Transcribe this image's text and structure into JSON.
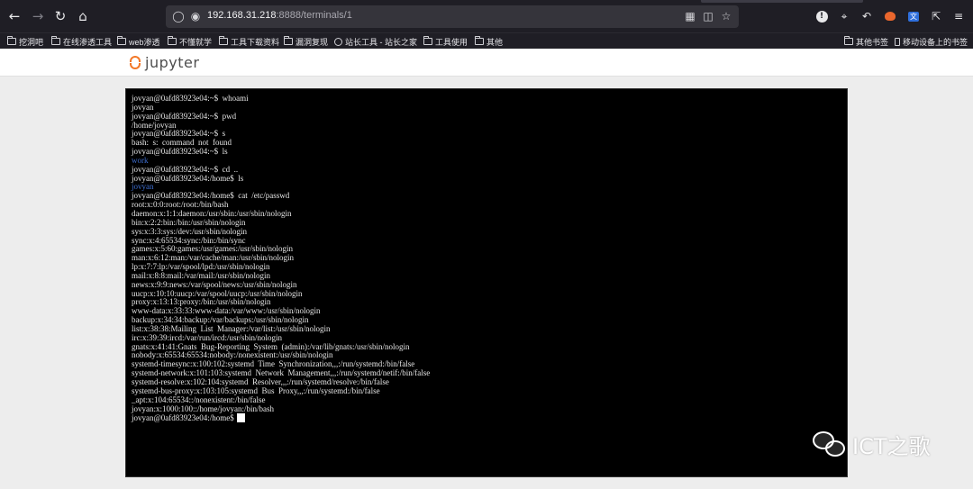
{
  "browser": {
    "url_host": "192.168.31.218",
    "url_rest": ":8888/terminals/1",
    "nav_icons": [
      "back-icon",
      "forward-icon",
      "reload-icon",
      "home-icon"
    ],
    "urlbar_icons": [
      "tracking-shield-icon",
      "lock-icon",
      "qr-code-icon",
      "translate-icon",
      "bookmark-star-icon"
    ],
    "extensions": [
      "info-icon",
      "crop-icon",
      "undo-icon",
      "fox-icon",
      "translate-ext-icon",
      "share-icon",
      "menu-icon"
    ]
  },
  "bookmarks": {
    "left": [
      {
        "label": "挖洞吧"
      },
      {
        "label": "在线渗透工具"
      },
      {
        "label": "web渗透"
      },
      {
        "label": "不懂就学"
      },
      {
        "label": "工具下载资料"
      },
      {
        "label": "漏洞复现"
      },
      {
        "label": "站长工具 - 站长之家"
      },
      {
        "label": "工具使用"
      },
      {
        "label": "其他"
      }
    ],
    "right": [
      {
        "label": "其他书签"
      },
      {
        "label": "移动设备上的书签"
      }
    ]
  },
  "jupyter": {
    "logo_text": "jupyter",
    "accent": "#f37726"
  },
  "terminal": {
    "lines": [
      {
        "text": "jovyan@0afd83923e04:~$  whoami",
        "kind": "normal"
      },
      {
        "text": "jovyan",
        "kind": "normal"
      },
      {
        "text": "jovyan@0afd83923e04:~$  pwd",
        "kind": "normal"
      },
      {
        "text": "/home/jovyan",
        "kind": "normal"
      },
      {
        "text": "jovyan@0afd83923e04:~$  s",
        "kind": "normal"
      },
      {
        "text": "bash:  s:  command  not  found",
        "kind": "normal"
      },
      {
        "text": "jovyan@0afd83923e04:~$  ls",
        "kind": "normal"
      },
      {
        "text": "work",
        "kind": "dir"
      },
      {
        "text": "jovyan@0afd83923e04:~$  cd  ..",
        "kind": "normal"
      },
      {
        "text": "jovyan@0afd83923e04:/home$  ls",
        "kind": "normal"
      },
      {
        "text": "jovyan",
        "kind": "dir"
      },
      {
        "text": "jovyan@0afd83923e04:/home$  cat  /etc/passwd",
        "kind": "normal"
      },
      {
        "text": "root:x:0:0:root:/root:/bin/bash",
        "kind": "normal"
      },
      {
        "text": "daemon:x:1:1:daemon:/usr/sbin:/usr/sbin/nologin",
        "kind": "normal"
      },
      {
        "text": "bin:x:2:2:bin:/bin:/usr/sbin/nologin",
        "kind": "normal"
      },
      {
        "text": "sys:x:3:3:sys:/dev:/usr/sbin/nologin",
        "kind": "normal"
      },
      {
        "text": "sync:x:4:65534:sync:/bin:/bin/sync",
        "kind": "normal"
      },
      {
        "text": "games:x:5:60:games:/usr/games:/usr/sbin/nologin",
        "kind": "normal"
      },
      {
        "text": "man:x:6:12:man:/var/cache/man:/usr/sbin/nologin",
        "kind": "normal"
      },
      {
        "text": "lp:x:7:7:lp:/var/spool/lpd:/usr/sbin/nologin",
        "kind": "normal"
      },
      {
        "text": "mail:x:8:8:mail:/var/mail:/usr/sbin/nologin",
        "kind": "normal"
      },
      {
        "text": "news:x:9:9:news:/var/spool/news:/usr/sbin/nologin",
        "kind": "normal"
      },
      {
        "text": "uucp:x:10:10:uucp:/var/spool/uucp:/usr/sbin/nologin",
        "kind": "normal"
      },
      {
        "text": "proxy:x:13:13:proxy:/bin:/usr/sbin/nologin",
        "kind": "normal"
      },
      {
        "text": "www-data:x:33:33:www-data:/var/www:/usr/sbin/nologin",
        "kind": "normal"
      },
      {
        "text": "backup:x:34:34:backup:/var/backups:/usr/sbin/nologin",
        "kind": "normal"
      },
      {
        "text": "list:x:38:38:Mailing  List  Manager:/var/list:/usr/sbin/nologin",
        "kind": "normal"
      },
      {
        "text": "irc:x:39:39:ircd:/var/run/ircd:/usr/sbin/nologin",
        "kind": "normal"
      },
      {
        "text": "gnats:x:41:41:Gnats  Bug-Reporting  System  (admin):/var/lib/gnats:/usr/sbin/nologin",
        "kind": "normal"
      },
      {
        "text": "nobody:x:65534:65534:nobody:/nonexistent:/usr/sbin/nologin",
        "kind": "normal"
      },
      {
        "text": "systemd-timesync:x:100:102:systemd  Time  Synchronization,,,:/run/systemd:/bin/false",
        "kind": "normal"
      },
      {
        "text": "systemd-network:x:101:103:systemd  Network  Management,,,:/run/systemd/netif:/bin/false",
        "kind": "normal"
      },
      {
        "text": "systemd-resolve:x:102:104:systemd  Resolver,,,:/run/systemd/resolve:/bin/false",
        "kind": "normal"
      },
      {
        "text": "systemd-bus-proxy:x:103:105:systemd  Bus  Proxy,,,:/run/systemd:/bin/false",
        "kind": "normal"
      },
      {
        "text": "_apt:x:104:65534::/nonexistent:/bin/false",
        "kind": "normal"
      },
      {
        "text": "jovyan:x:1000:100::/home/jovyan:/bin/bash",
        "kind": "normal"
      }
    ],
    "prompt": "jovyan@0afd83923e04:/home$"
  },
  "watermark": {
    "text": "ICT之歌"
  }
}
